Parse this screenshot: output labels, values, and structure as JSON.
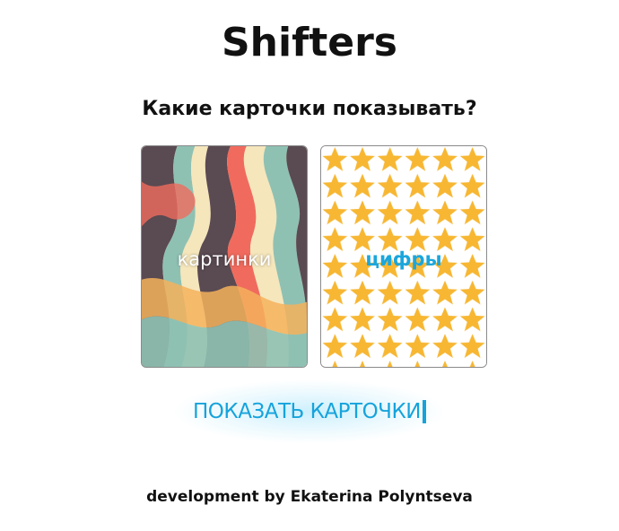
{
  "header": {
    "title": "Shifters",
    "question": "Какие карточки показывать?"
  },
  "cards": {
    "pictures": {
      "label": "картинки",
      "pattern": "retro-wave-pattern",
      "colors": [
        "#5a4a52",
        "#f5e6bc",
        "#8fc1b3",
        "#f06b5e",
        "#f4b25c"
      ]
    },
    "numbers": {
      "label": "цифры",
      "pattern": "star-pattern",
      "colors": [
        "#f7b733",
        "#ffffff"
      ]
    }
  },
  "action": {
    "show_label": "ПОКАЗАТЬ КАРТОЧКИ",
    "accent": "#16a3dc"
  },
  "footer": {
    "credit": "development by Ekaterina Polyntseva"
  }
}
